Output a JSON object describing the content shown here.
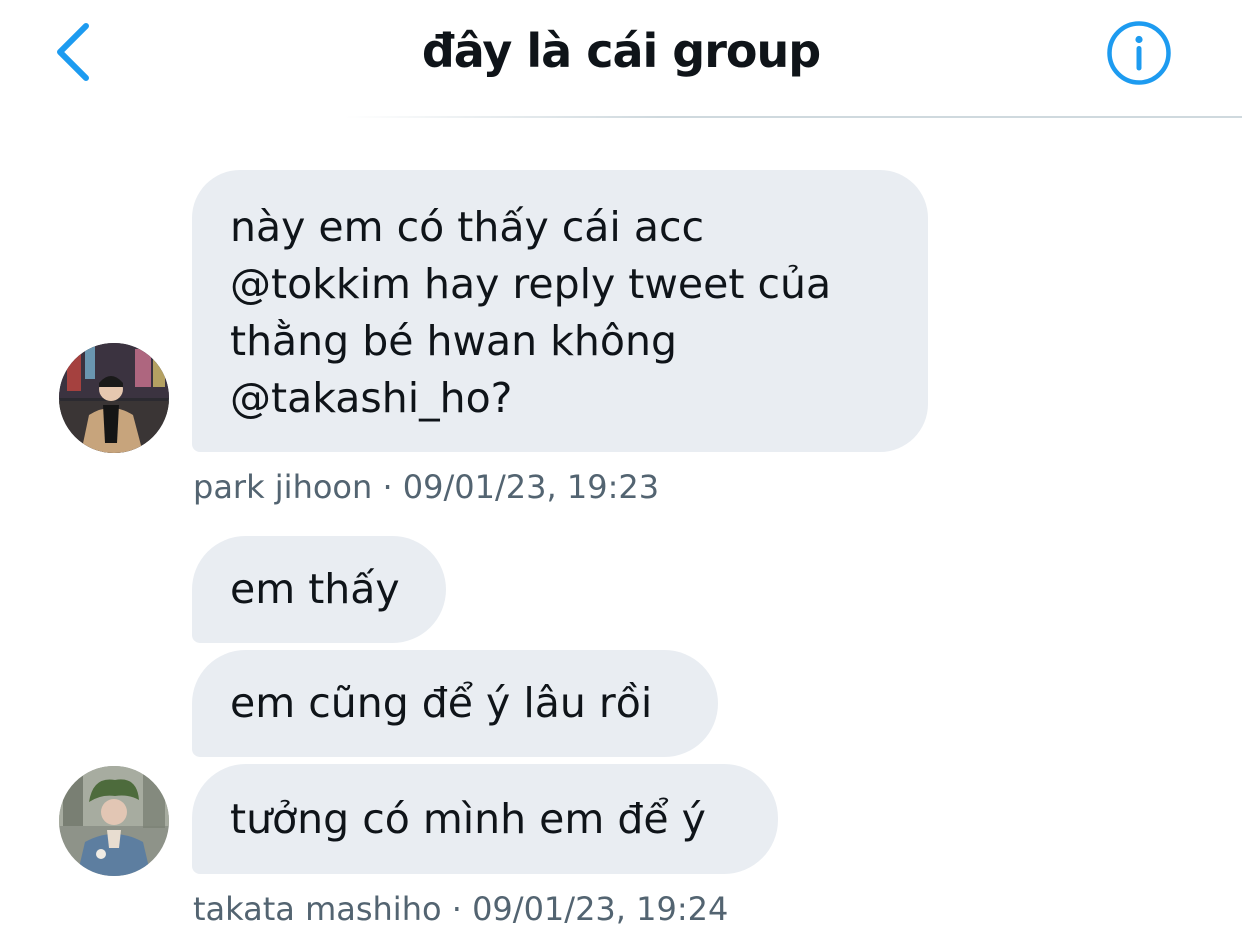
{
  "header": {
    "title": "đây là cái group",
    "back_icon": "chevron-left-icon",
    "info_icon": "info-circle-icon",
    "accent_color": "#1d9bf0"
  },
  "messages": [
    {
      "text": "này em có thấy cái acc\n@tokkim hay reply tweet của\nthằng bé hwan không\n@takashi_ho?"
    },
    {
      "text": "em thấy"
    },
    {
      "text": "em cũng để ý lâu rồi"
    },
    {
      "text": "tưởng có mình em để ý"
    }
  ],
  "groups": [
    {
      "meta": "park jihoon · 09/01/23, 19:23",
      "avatar_icon": "user-avatar-photo"
    },
    {
      "meta": "takata mashiho · 09/01/23, 19:24",
      "avatar_icon": "user-avatar-photo"
    }
  ],
  "colors": {
    "bubble_background": "#e9edf2",
    "text": "#0f1419",
    "meta_text": "#536471"
  }
}
